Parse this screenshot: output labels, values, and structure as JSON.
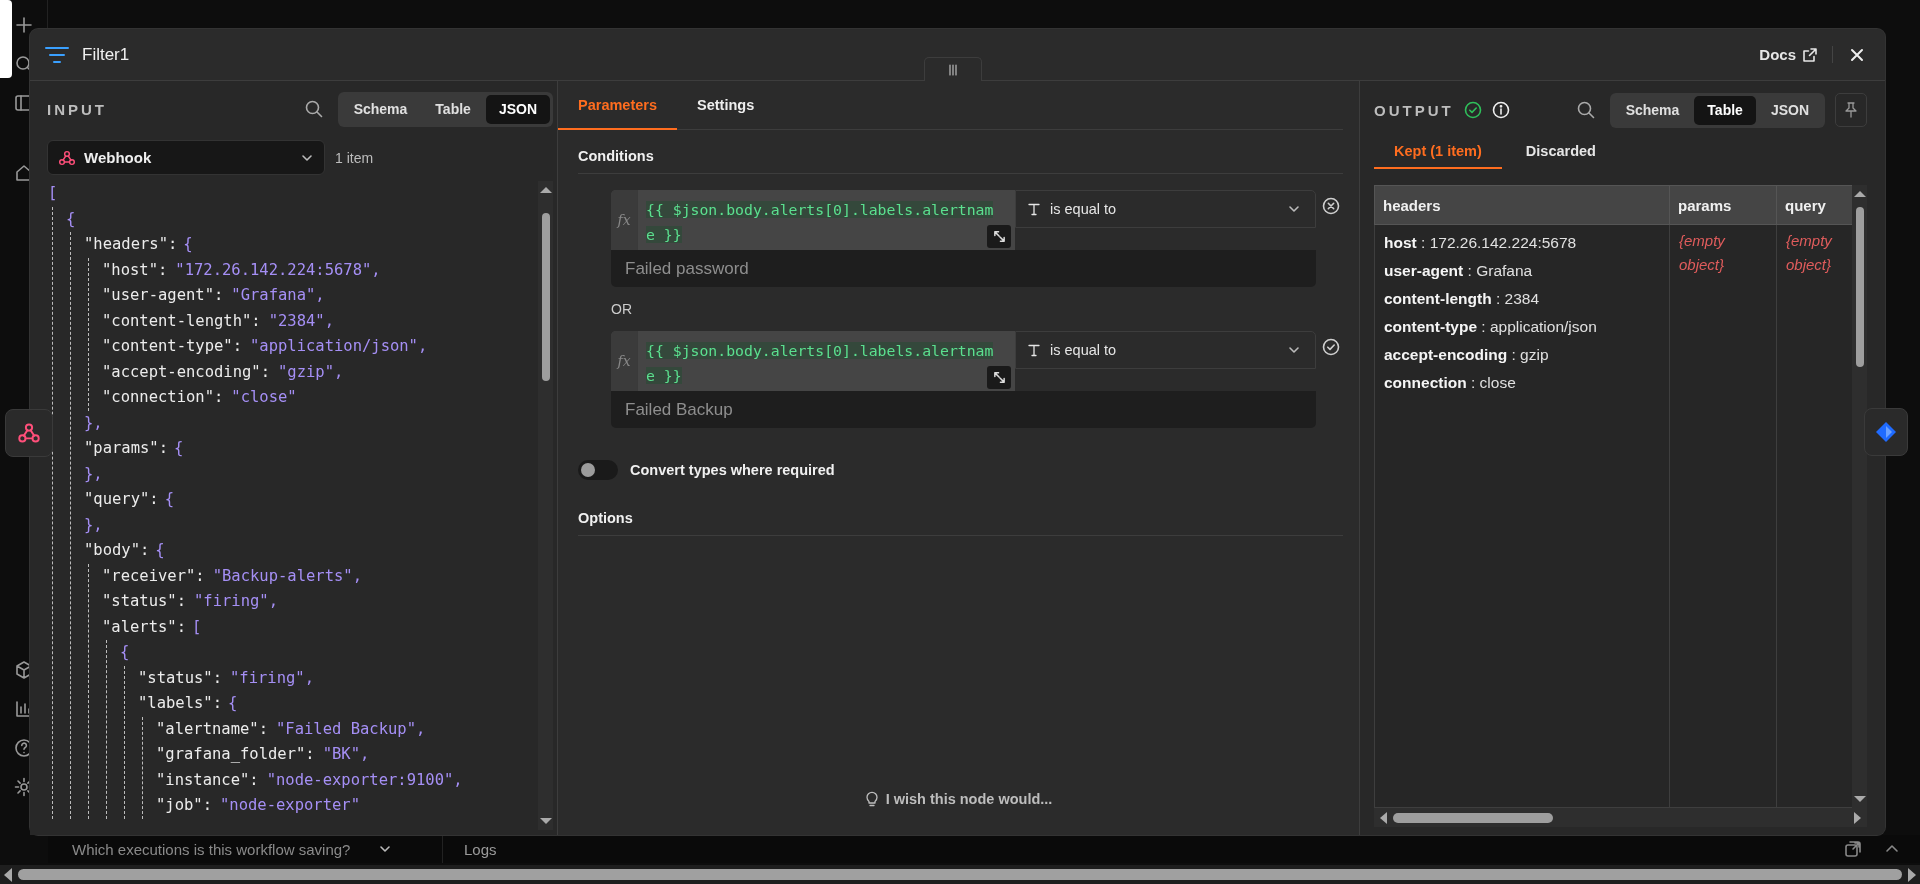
{
  "window": {
    "title": "Filter1",
    "docs_link": "Docs"
  },
  "input": {
    "label": "INPUT",
    "view_tabs": [
      {
        "label": "Schema",
        "selected": false
      },
      {
        "label": "Table",
        "selected": false
      },
      {
        "label": "JSON",
        "selected": true
      }
    ],
    "source": "Webhook",
    "item_count": "1 item",
    "json": {
      "open": "[",
      "children": [
        {
          "open": "{",
          "children": [
            {
              "key": "\"headers\":",
              "open": "{",
              "close": "},",
              "children": [
                {
                  "key": "\"host\":",
                  "value": "\"172.26.142.224:5678\"",
                  "comma": ","
                },
                {
                  "key": "\"user-agent\":",
                  "value": "\"Grafana\"",
                  "comma": ","
                },
                {
                  "key": "\"content-length\":",
                  "value": "\"2384\"",
                  "comma": ","
                },
                {
                  "key": "\"content-type\":",
                  "value": "\"application/json\"",
                  "comma": ","
                },
                {
                  "key": "\"accept-encoding\":",
                  "value": "\"gzip\"",
                  "comma": ","
                },
                {
                  "key": "\"connection\":",
                  "value": "\"close\""
                }
              ]
            },
            {
              "key": "\"params\":",
              "open": "{",
              "close": "},"
            },
            {
              "key": "\"query\":",
              "open": "{",
              "close": "},"
            },
            {
              "key": "\"body\":",
              "open": "{",
              "children": [
                {
                  "key": "\"receiver\":",
                  "value": "\"Backup-alerts\"",
                  "comma": ","
                },
                {
                  "key": "\"status\":",
                  "value": "\"firing\"",
                  "comma": ","
                },
                {
                  "key": "\"alerts\":",
                  "open": "[",
                  "children": [
                    {
                      "open": "{",
                      "children": [
                        {
                          "key": "\"status\":",
                          "value": "\"firing\"",
                          "comma": ","
                        },
                        {
                          "key": "\"labels\":",
                          "open": "{",
                          "children": [
                            {
                              "key": "\"alertname\":",
                              "value": "\"Failed Backup\"",
                              "comma": ","
                            },
                            {
                              "key": "\"grafana_folder\":",
                              "value": "\"BK\"",
                              "comma": ","
                            },
                            {
                              "key": "\"instance\":",
                              "value": "\"node-exporter:9100\"",
                              "comma": ","
                            },
                            {
                              "key": "\"job\":",
                              "value": "\"node-exporter\""
                            }
                          ]
                        }
                      ]
                    }
                  ]
                }
              ]
            }
          ]
        }
      ]
    }
  },
  "parameters": {
    "tabs": [
      {
        "label": "Parameters",
        "selected": true
      },
      {
        "label": "Settings",
        "selected": false
      }
    ],
    "conditions_title": "Conditions",
    "conditions": [
      {
        "mode": "fx",
        "expression": "{{ $json.body.alerts[0].labels.alertname }}",
        "operator": "is equal to",
        "value": "Failed password"
      },
      {
        "mode": "fx",
        "expression": "{{ $json.body.alerts[0].labels.alertname }}",
        "operator": "is equal to",
        "value": "Failed Backup"
      }
    ],
    "combinator": "OR",
    "convert_types": {
      "label": "Convert types where required",
      "on": false
    },
    "options_title": "Options",
    "feedback": "I wish this node would..."
  },
  "output": {
    "label": "OUTPUT",
    "view_tabs": [
      {
        "label": "Schema",
        "selected": false
      },
      {
        "label": "Table",
        "selected": true
      },
      {
        "label": "JSON",
        "selected": false
      }
    ],
    "result_tabs": [
      {
        "label": "Kept (1 item)",
        "selected": true
      },
      {
        "label": "Discarded",
        "selected": false
      }
    ],
    "table": {
      "columns": [
        "headers",
        "params",
        "query"
      ],
      "rows": [
        {
          "headers": [
            "**host** : 172.26.142.224:5678",
            "**user-agent** : Grafana",
            "**content-length** : 2384",
            "**content-type** : application/json",
            "**accept-encoding** : gzip",
            "**connection** : close"
          ],
          "params": "{empty object}",
          "query": "{empty object}"
        }
      ]
    }
  },
  "bottom_bar": {
    "executions_prompt": "Which executions is this workflow saving?",
    "logs": "Logs"
  }
}
